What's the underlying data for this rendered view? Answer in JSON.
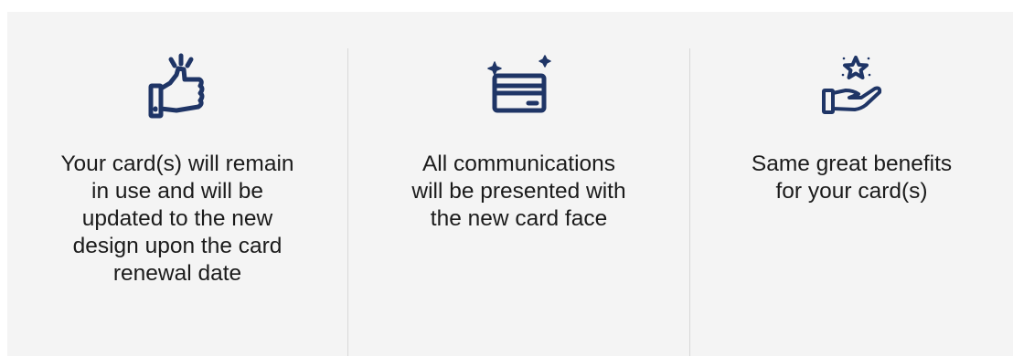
{
  "theme": {
    "panel_bg": "#f4f4f4",
    "icon_color": "#1f3566",
    "text_color": "#1b1b1b",
    "divider_color": "#d8d8d8"
  },
  "features": [
    {
      "icon": "thumbs-up-icon",
      "lines": [
        "Your card(s) will remain",
        "in use and will be",
        "updated to the new",
        "design upon the card",
        "renewal date"
      ]
    },
    {
      "icon": "credit-card-icon",
      "lines": [
        "All communications",
        "will be presented with",
        "the new card face"
      ]
    },
    {
      "icon": "hand-star-icon",
      "lines": [
        "Same great benefits",
        "for your card(s)"
      ]
    }
  ]
}
